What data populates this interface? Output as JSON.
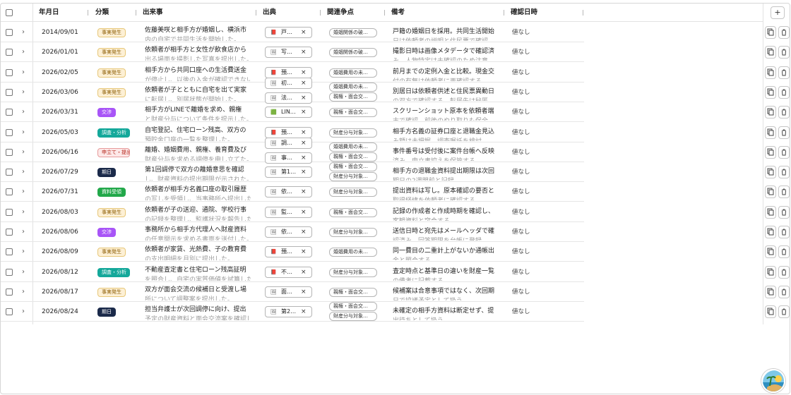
{
  "columns": {
    "date": "年月日",
    "category": "分類",
    "event": "出来事",
    "source": "出典",
    "issues": "関連争点",
    "notes": "備考",
    "confirmed": "確認日時"
  },
  "add_label": "+",
  "categories": {
    "fact": {
      "label": "事実発生",
      "bg": "#fdf0d5",
      "border": "#e7c779",
      "color": "#8a5a00"
    },
    "nego": {
      "label": "交渉",
      "bg": "#a855f7",
      "border": "#a855f7",
      "color": "#ffffff"
    },
    "analysis": {
      "label": "調査・分析",
      "bg": "#14a89a",
      "border": "#14a89a",
      "color": "#ffffff"
    },
    "filing": {
      "label": "申立て・提出",
      "bg": "#fde8e8",
      "border": "#e79a9a",
      "color": "#b42318"
    },
    "deadline": {
      "label": "期日",
      "bg": "#1b2a4a",
      "border": "#1b2a4a",
      "color": "#ffffff"
    },
    "received": {
      "label": "資料受領",
      "bg": "#22a84a",
      "border": "#22a84a",
      "color": "#ffffff"
    }
  },
  "rows": [
    {
      "date": "2014/09/01",
      "cat": "fact",
      "event1": "佐藤美咲と相手方が婚姻し、横浜市",
      "event2": "内の自宅で共同生活を開始した。",
      "sources": [
        {
          "icon": "pdf-icon",
          "label": "戸…"
        }
      ],
      "issues": [
        "婚姻関係の破…"
      ],
      "note1": "戸籍の婚姻日を採用。共同生活開始",
      "note2": "日は依頼者の説明と住民票で確認。",
      "conf": "値なし"
    },
    {
      "date": "2026/01/01",
      "cat": "fact",
      "event1": "依頼者が相手方と女性が飲食店から",
      "event2": "出る場面を撮影した写真を提出した。",
      "sources": [
        {
          "icon": "image-icon",
          "label": "写…"
        }
      ],
      "issues": [
        "婚姻関係の破…"
      ],
      "note1": "撮影日時は画像メタデータで確認済",
      "note2": "み。人物特定は未確認のため注意。",
      "conf": "値なし"
    },
    {
      "date": "2026/02/05",
      "cat": "fact",
      "event1": "相手方から共同口座への生活費送金",
      "event2": "が停止し、以後の入金が確認できない。",
      "sources": [
        {
          "icon": "pdf-icon",
          "label": "預…"
        }
      ],
      "issues": [
        "婚姻費用の未…"
      ],
      "note1": "前月までの定例入金と比較。現金交",
      "note2": "付の有無は依頼者に再確認する。",
      "conf": "値なし"
    },
    {
      "date": "2026/03/06",
      "cat": "fact",
      "event1": "依頼者が子とともに自宅を出て実家",
      "event2": "に転居し、別居状態が開始した。",
      "sources": [
        {
          "icon": "image-icon",
          "label": "初…"
        },
        {
          "icon": "image-icon",
          "label": "法…"
        }
      ],
      "issues": [
        "婚姻費用の未…",
        "親権・面会交…"
      ],
      "note1": "別居日は依頼者供述と住民票異動日",
      "note2": "の双方で確認する。転居先は秘匿。",
      "conf": "値なし"
    },
    {
      "date": "2026/03/31",
      "cat": "nego",
      "event1": "相手方がLINEで離婚を求め、親権",
      "event2": "と財産分与について条件を提示した。",
      "sources": [
        {
          "icon": "line-icon",
          "label": "LIN…"
        }
      ],
      "issues": [
        "親権・面会交…"
      ],
      "note1": "スクリーンショット原本を依頼者端",
      "note2": "末で確認。前後のやり取りも保全。",
      "conf": "値なし"
    },
    {
      "date": "2026/05/03",
      "cat": "analysis",
      "event1": "自宅登記、住宅ローン残高、双方の",
      "event2": "預貯金口座の一覧を整理した。",
      "sources": [
        {
          "icon": "pdf-icon",
          "label": "預…"
        }
      ],
      "issues": [
        "財産分与対象…"
      ],
      "note1": "相手方名義の証券口座と退職金見込",
      "note2": "み額は未把握。調査嘱託を検討。",
      "conf": "値なし"
    },
    {
      "date": "2026/06/16",
      "cat": "filing",
      "event1": "離婚、婚姻費用、親権、養育費及び",
      "event2": "財産分与を求める調停を申し立てた。",
      "sources": [
        {
          "icon": "image-icon",
          "label": "調…"
        },
        {
          "icon": "image-icon",
          "label": "事…"
        }
      ],
      "issues": [
        "婚姻費用の未…",
        "親権・面会交…"
      ],
      "note1": "事件番号は受付後に案件台帳へ反映",
      "note2": "済み。申立書控えを保管する。",
      "conf": "値なし"
    },
    {
      "date": "2026/07/29",
      "cat": "deadline",
      "event1": "第1回調停で双方の離婚意思を確認",
      "event2": "し、財産資料の提出期限が示された。",
      "sources": [
        {
          "icon": "image-icon",
          "label": "第1…"
        }
      ],
      "issues": [
        "親権・面会交…",
        "財産分与対象…"
      ],
      "note1": "相手方の退職金資料提出期限は次回",
      "note2": "期日の2週間前と記録。",
      "conf": "値なし"
    },
    {
      "date": "2026/07/31",
      "cat": "received",
      "event1": "依頼者が相手方名義口座の取引履歴",
      "event2": "の写しを受領し、当事務所へ提出した。",
      "sources": [
        {
          "icon": "image-icon",
          "label": "依…"
        }
      ],
      "issues": [
        "財産分与対象…"
      ],
      "note1": "提出資料は写し。原本確認の要否と",
      "note2": "取得経緯を依頼者に確認する。",
      "conf": "値なし"
    },
    {
      "date": "2026/08/03",
      "cat": "fact",
      "event1": "依頼者が子の送迎、通院、学校行事",
      "event2": "の記録を整理し、監護状況を報告した。",
      "sources": [
        {
          "icon": "image-icon",
          "label": "監…"
        }
      ],
      "issues": [
        "親権・面会交…"
      ],
      "note1": "記録の作成者と作成時期を確認し、",
      "note2": "客観資料と突合する。",
      "conf": "値なし"
    },
    {
      "date": "2026/08/06",
      "cat": "nego",
      "event1": "事務所から相手方代理人へ財産資料",
      "event2": "の任意開示を求める書面を送付した。",
      "sources": [
        {
          "icon": "image-icon",
          "label": "依…"
        }
      ],
      "issues": [
        "財産分与対象…"
      ],
      "note1": "送信日時と宛先はメールヘッダで確",
      "note2": "認済み。回答期限を台帳に登録。",
      "conf": "値なし"
    },
    {
      "date": "2026/08/09",
      "cat": "fact",
      "event1": "依頼者が家賃、光熱費、子の教育費",
      "event2": "の支出明細を月別に提出した。",
      "sources": [
        {
          "icon": "pdf-icon",
          "label": "預…"
        }
      ],
      "issues": [
        "婚姻費用の未…"
      ],
      "note1": "同一費目の二重計上がないか通帳出",
      "note2": "金と照合する。",
      "conf": "値なし"
    },
    {
      "date": "2026/08/12",
      "cat": "analysis",
      "event1": "不動産査定書と住宅ローン残高証明",
      "event2": "を照合し、自宅の実質価値を試算した。",
      "sources": [
        {
          "icon": "pdf-icon",
          "label": "不…"
        }
      ],
      "issues": [
        "財産分与対象…"
      ],
      "note1": "査定時点と基準日の違いを財産一覧",
      "note2": "の備考に記載する。",
      "conf": "値なし"
    },
    {
      "date": "2026/08/17",
      "cat": "fact",
      "event1": "双方が面会交流の候補日と受渡し場",
      "event2": "所について調整案を提出した。",
      "sources": [
        {
          "icon": "image-icon",
          "label": "面…"
        }
      ],
      "issues": [
        "親権・面会交…"
      ],
      "note1": "候補案は合意事項ではなく、次回期",
      "note2": "日で協議予定として扱う。",
      "conf": "値なし"
    },
    {
      "date": "2026/08/24",
      "cat": "deadline",
      "event1": "担当弁護士が次回調停に向け、提出",
      "event2": "予定の財産資料と面会交流案を確認した。",
      "sources": [
        {
          "icon": "image-icon",
          "label": "第2…"
        }
      ],
      "issues": [
        "親権・面会交…",
        "財産分与対象…"
      ],
      "note1": "未確定の相手方資料は断定せず、提",
      "note2": "出待ちとして扱う。",
      "conf": "値なし"
    }
  ]
}
